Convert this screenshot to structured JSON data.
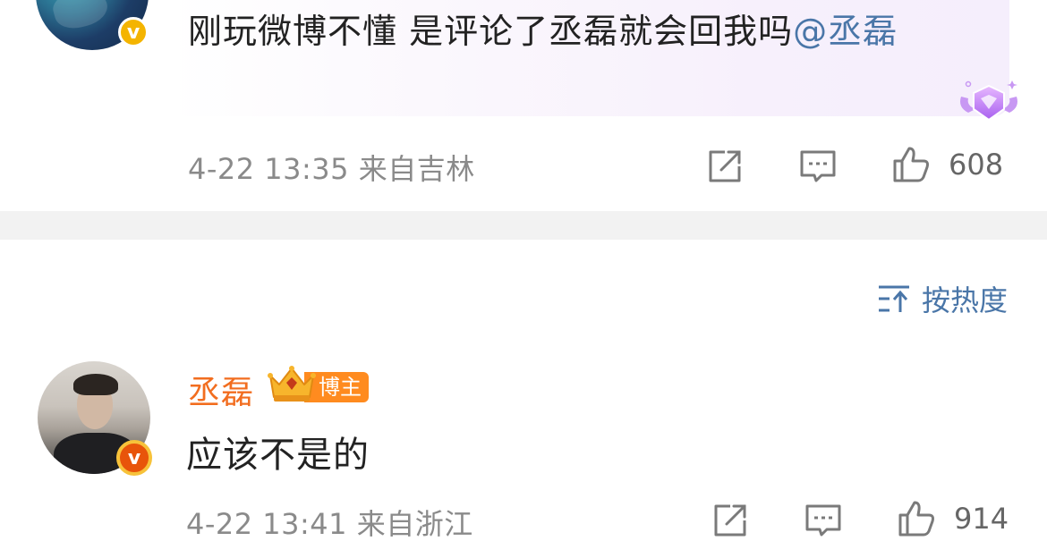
{
  "top_comment": {
    "text": "刚玩微博不懂 是评论了丞磊就会回我吗",
    "mention": "@丞磊",
    "time": "4-22 13:35",
    "location": "来自吉林",
    "like_count": "608",
    "badge_icon": "verified-v-icon",
    "decoration_icon": "diamond-wings-icon"
  },
  "sort": {
    "label": "按热度",
    "icon": "sort-icon"
  },
  "reply_comment": {
    "username": "丞磊",
    "author_tag": "博主",
    "text": "应该不是的",
    "time": "4-22 13:41",
    "location": "来自浙江",
    "like_count": "914",
    "badge_icon": "verified-v-icon",
    "crown_icon": "crown-icon"
  },
  "colors": {
    "link": "#4a76a8",
    "username": "#f26d1f",
    "meta_text": "#8a8a8a",
    "divider": "#f2f2f2",
    "badge_gold": "#f4b400",
    "author_tag_bg": "#ff8b1f"
  }
}
